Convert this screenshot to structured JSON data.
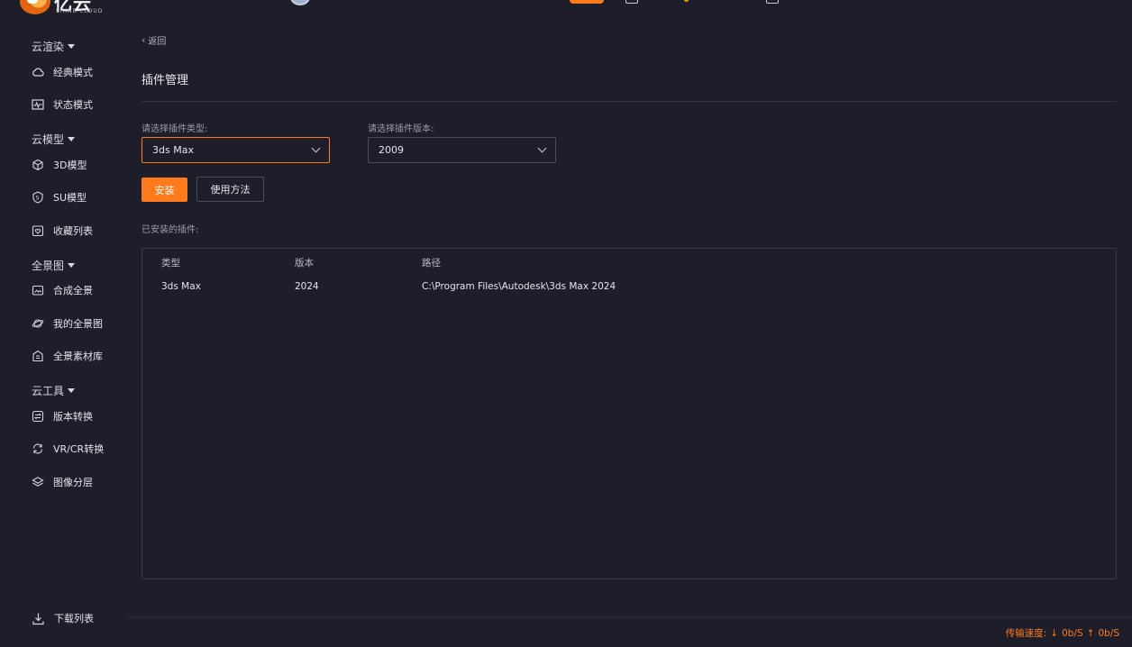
{
  "top": {
    "brand": "亿云",
    "brand_sub": "SHINE CLOUD"
  },
  "sidebar": {
    "sections": [
      {
        "title": "云渲染",
        "items": [
          {
            "label": "经典模式",
            "icon": "cloud-icon"
          },
          {
            "label": "状态模式",
            "icon": "pulse-monitor-icon"
          }
        ]
      },
      {
        "title": "云模型",
        "items": [
          {
            "label": "3D模型",
            "icon": "cube-icon"
          },
          {
            "label": "SU模型",
            "icon": "su-shield-icon"
          },
          {
            "label": "收藏列表",
            "icon": "heart-box-icon"
          }
        ]
      },
      {
        "title": "全景图",
        "items": [
          {
            "label": "合成全景",
            "icon": "panorama-compose-icon"
          },
          {
            "label": "我的全景图",
            "icon": "orbit-globe-icon"
          },
          {
            "label": "全景素材库",
            "icon": "library-icon"
          }
        ]
      },
      {
        "title": "云工具",
        "items": [
          {
            "label": "版本转换",
            "icon": "convert-icon"
          },
          {
            "label": "VR/CR转换",
            "icon": "sync-icon"
          },
          {
            "label": "图像分层",
            "icon": "layers-icon"
          }
        ]
      }
    ],
    "download_list": "下载列表"
  },
  "main": {
    "back": "返回",
    "title": "插件管理",
    "plugin_type_label": "请选择插件类型:",
    "plugin_type_value": "3ds Max",
    "plugin_version_label": "请选择插件版本:",
    "plugin_version_value": "2009",
    "install_button": "安装",
    "usage_button": "使用方法",
    "installed_label": "已安装的插件:",
    "table": {
      "headers": [
        "类型",
        "版本",
        "路径"
      ],
      "rows": [
        [
          "3ds Max",
          "2024",
          "C:\\Program Files\\Autodesk\\3ds Max 2024"
        ]
      ]
    }
  },
  "footer": {
    "speed_label": "传输速度:",
    "download_speed": "0b/S",
    "upload_speed": "0b/S"
  },
  "colors": {
    "background": "#1e1e2b",
    "accent": "#ff7a1a",
    "border": "#4a4b58"
  }
}
